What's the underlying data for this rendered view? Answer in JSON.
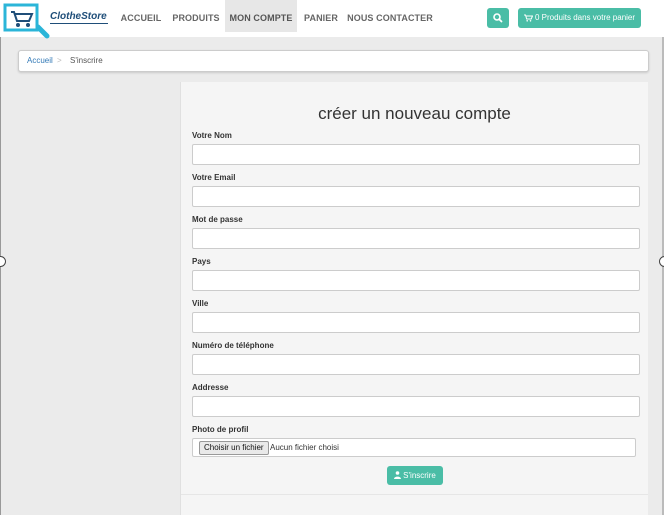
{
  "brand": {
    "name": "ClotheStore"
  },
  "nav": {
    "items": [
      {
        "label": "ACCUEIL"
      },
      {
        "label": "PRODUITS"
      },
      {
        "label": "MON COMPTE",
        "active": true
      },
      {
        "label": "PANIER"
      },
      {
        "label": "NOUS CONTACTER"
      }
    ],
    "cart_label": "0 Produits dans votre panier"
  },
  "breadcrumb": {
    "home": "Accueil",
    "separator": ">",
    "current": "S'inscrire"
  },
  "form": {
    "title": "créer un nouveau compte",
    "fields": [
      {
        "label": "Votre Nom",
        "value": ""
      },
      {
        "label": "Votre Email",
        "value": ""
      },
      {
        "label": "Mot de passe",
        "value": ""
      },
      {
        "label": "Pays",
        "value": ""
      },
      {
        "label": "Ville",
        "value": ""
      },
      {
        "label": "Numéro de téléphone",
        "value": ""
      },
      {
        "label": "Addresse",
        "value": ""
      }
    ],
    "photo": {
      "label": "Photo de profil",
      "button_label": "Choisir un fichier",
      "status": "Aucun fichier choisi"
    },
    "submit_label": "S'inscrire"
  },
  "colors": {
    "accent": "#4abda6",
    "link": "#337ab7",
    "brand": "#1f4e79",
    "logo_cyan": "#2bb5d8"
  },
  "icons": {
    "search": "search-icon",
    "cart": "cart-icon",
    "user": "user-icon"
  }
}
